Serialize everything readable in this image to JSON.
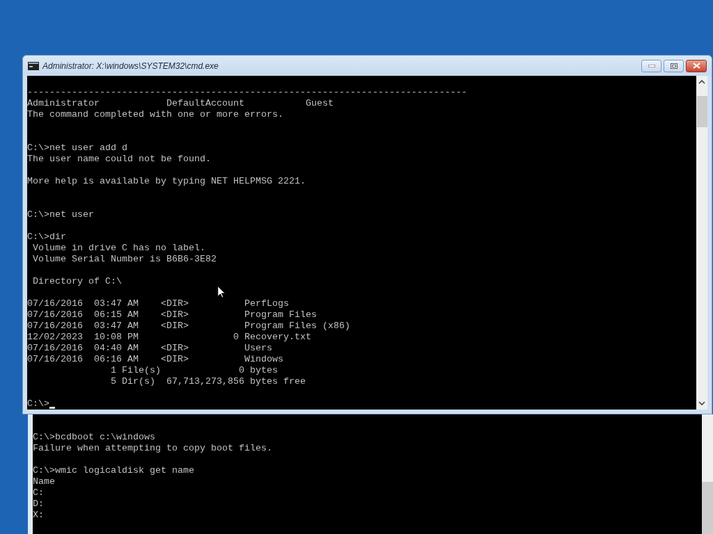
{
  "back_window": {
    "lines": [
      {
        "kind": "blank"
      },
      {
        "kind": "text",
        "text": "C:\\>bcdboot c:\\windows"
      },
      {
        "kind": "text",
        "text": "Failure when attempting to copy boot files."
      },
      {
        "kind": "blank"
      },
      {
        "kind": "text",
        "text": "C:\\>wmic logicaldisk get name"
      },
      {
        "kind": "text",
        "text": "Name"
      },
      {
        "kind": "text",
        "text": "C:"
      },
      {
        "kind": "text",
        "text": "D:"
      },
      {
        "kind": "text",
        "text": "X:"
      }
    ]
  },
  "window": {
    "title": "Administrator: X:\\windows\\SYSTEM32\\cmd.exe",
    "lines": [
      {
        "kind": "blank"
      },
      {
        "kind": "text",
        "text": "-------------------------------------------------------------------------------"
      },
      {
        "kind": "text",
        "text": "Administrator            DefaultAccount           Guest"
      },
      {
        "kind": "text",
        "text": "The command completed with one or more errors."
      },
      {
        "kind": "blank"
      },
      {
        "kind": "blank"
      },
      {
        "kind": "text",
        "text": "C:\\>net user add d"
      },
      {
        "kind": "text",
        "text": "The user name could not be found."
      },
      {
        "kind": "blank"
      },
      {
        "kind": "text",
        "text": "More help is available by typing NET HELPMSG 2221."
      },
      {
        "kind": "blank"
      },
      {
        "kind": "blank"
      },
      {
        "kind": "text",
        "text": "C:\\>net user"
      },
      {
        "kind": "blank"
      },
      {
        "kind": "text",
        "text": "C:\\>dir"
      },
      {
        "kind": "text",
        "text": " Volume in drive C has no label."
      },
      {
        "kind": "text",
        "text": " Volume Serial Number is B6B6-3E82"
      },
      {
        "kind": "blank"
      },
      {
        "kind": "text",
        "text": " Directory of C:\\"
      },
      {
        "kind": "blank"
      },
      {
        "kind": "text",
        "text": "07/16/2016  03:47 AM    <DIR>          PerfLogs"
      },
      {
        "kind": "text",
        "text": "07/16/2016  06:15 AM    <DIR>          Program Files"
      },
      {
        "kind": "text",
        "text": "07/16/2016  03:47 AM    <DIR>          Program Files (x86)"
      },
      {
        "kind": "text",
        "text": "12/02/2023  10:08 PM                 0 Recovery.txt"
      },
      {
        "kind": "text",
        "text": "07/16/2016  04:40 AM    <DIR>          Users"
      },
      {
        "kind": "text",
        "text": "07/16/2016  06:16 AM    <DIR>          Windows"
      },
      {
        "kind": "text",
        "text": "               1 File(s)              0 bytes"
      },
      {
        "kind": "text",
        "text": "               5 Dir(s)  67,713,273,856 bytes free"
      },
      {
        "kind": "blank"
      },
      {
        "kind": "prompt",
        "text": "C:\\>"
      }
    ]
  }
}
